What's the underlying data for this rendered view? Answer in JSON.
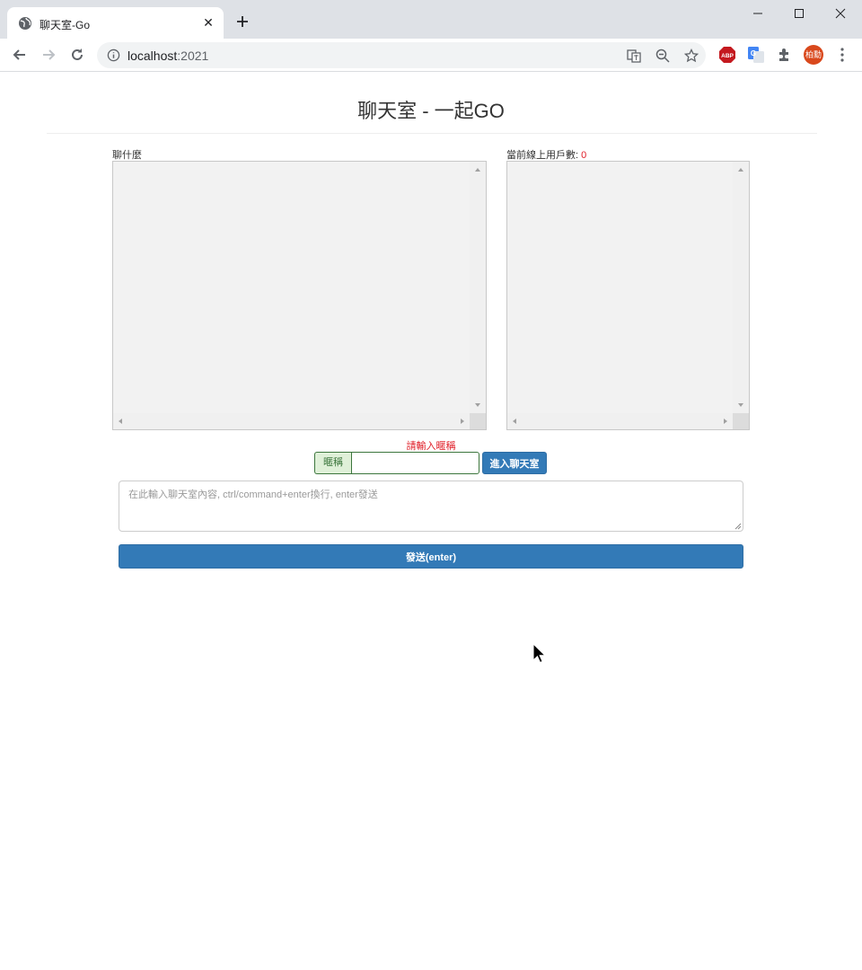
{
  "browser": {
    "tab_title": "聊天室-Go",
    "tab_close": "✕",
    "url_host": "localhost",
    "url_port": ":2021",
    "profile_label": "柏勳"
  },
  "page": {
    "title": "聊天室 - 一起GO"
  },
  "chat_panel": {
    "label": "聊什麼"
  },
  "users_panel": {
    "label": "當前線上用戶數:",
    "count": "0"
  },
  "nickname": {
    "hint": "請輸入暱稱",
    "addon_label": "暱稱",
    "value": "",
    "join_label": "進入聊天室"
  },
  "message": {
    "placeholder": "在此輸入聊天室內容, ctrl/command+enter換行, enter發送",
    "value": ""
  },
  "send": {
    "label": "發送(enter)"
  },
  "colors": {
    "primary": "#337ab7",
    "alert": "#e0202a",
    "success_bg": "#dff0d8",
    "success_border": "#3c763d"
  }
}
